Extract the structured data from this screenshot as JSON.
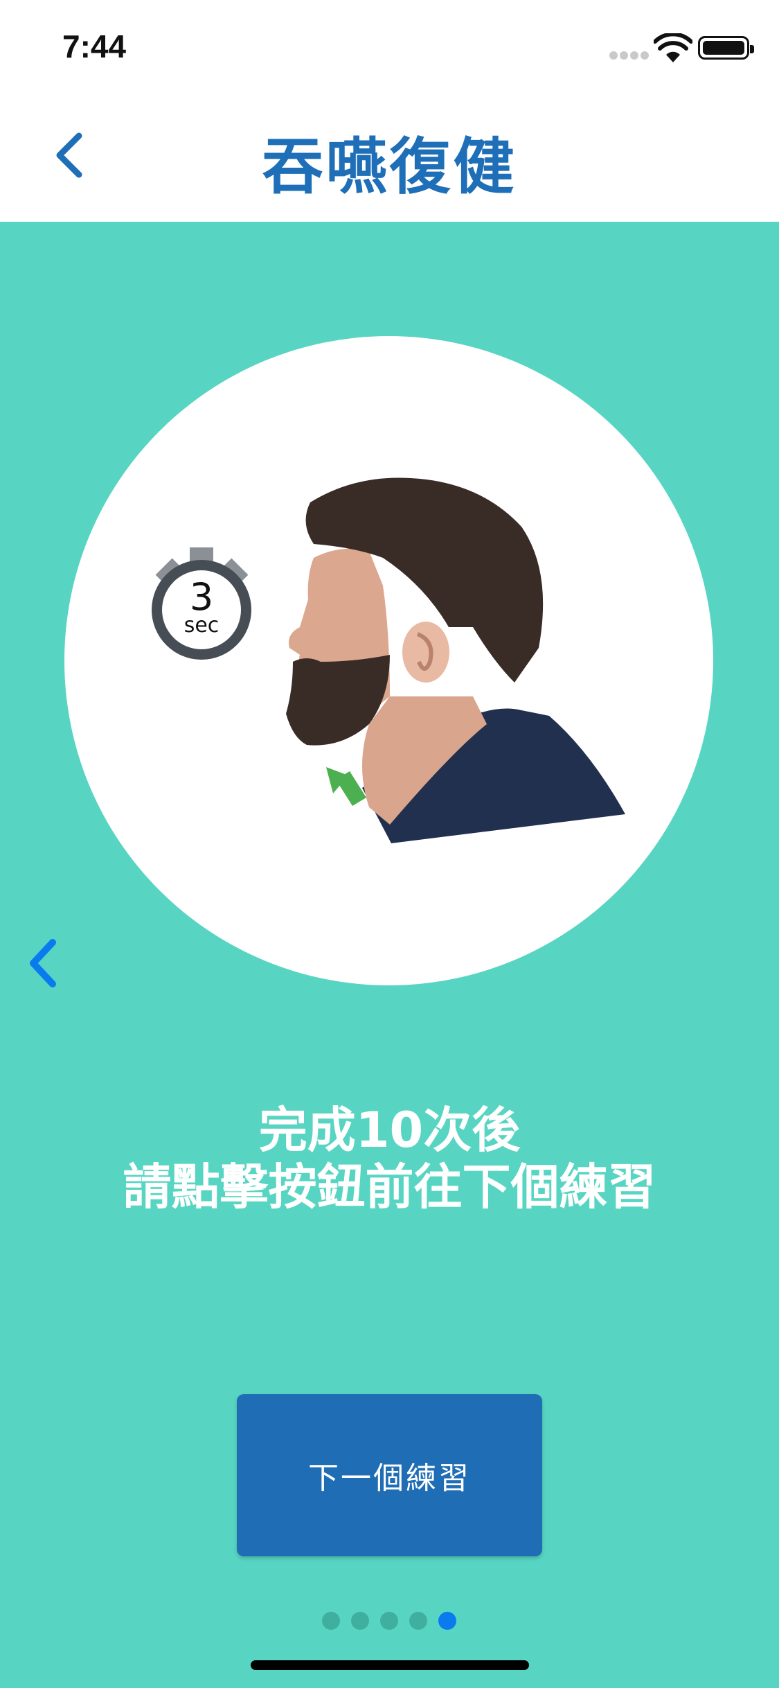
{
  "status_bar": {
    "time": "7:44"
  },
  "nav": {
    "title": "吞嚥復健"
  },
  "timer": {
    "number": "3",
    "unit": "sec"
  },
  "instruction": {
    "line1": "完成10次後",
    "line2": "請點擊按鈕前往下個練習"
  },
  "next_button": {
    "label": "下一個練習"
  },
  "pager": {
    "count": 5,
    "active_index": 4
  },
  "colors": {
    "background": "#57D5C2",
    "accent": "#1E6FB8",
    "button": "#1F6DB5",
    "active_dot": "#0A7BEF",
    "arrow": "#4CAF50"
  }
}
